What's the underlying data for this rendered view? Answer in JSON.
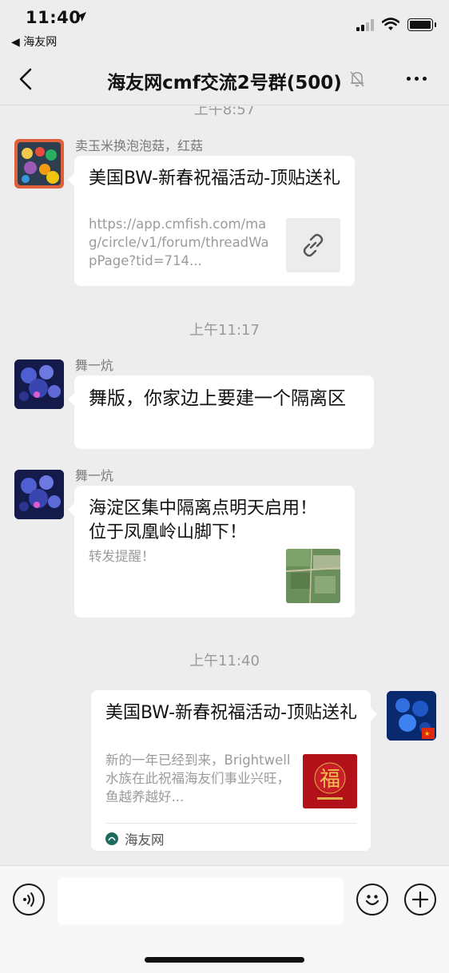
{
  "status_bar": {
    "time": "11:40",
    "back_app_label": "◀ 海友网"
  },
  "header": {
    "title": "海友网cmf交流2号群(500)"
  },
  "messages": [
    {
      "timestamp_partial": "上午8:57",
      "sender": "卖玉米换泡泡菇，红菇",
      "card_title": "美国BW-新春祝福活动-顶贴送礼",
      "card_desc": "https://app.cmfish.com/mag/circle/v1/forum/threadWapPage?tid=714..."
    },
    {
      "timestamp": "上午11:17",
      "sender": "舞一炕",
      "text": "舞版，你家边上要建一个隔离区"
    },
    {
      "sender": "舞一炕",
      "card_title": "海淀区集中隔离点明天启用！位于凤凰岭山脚下！",
      "card_desc": "转发提醒！"
    },
    {
      "timestamp": "上午11:40",
      "card_title": "美国BW-新春祝福活动-顶贴送礼",
      "card_desc": "新的一年已经到来，Brightwell水族在此祝福海友们事业兴旺，鱼越养越好...",
      "source": "海友网"
    }
  ],
  "colors": {
    "background": "#ededed",
    "bubble": "#ffffff",
    "secondary_text": "#9b9b9b"
  }
}
